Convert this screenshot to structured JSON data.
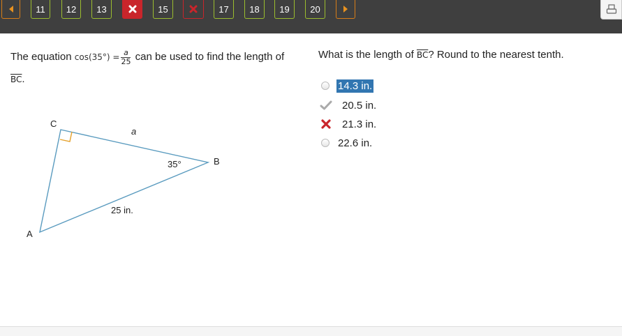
{
  "nav": {
    "prev_icon": "left-arrow-icon",
    "next_icon": "right-arrow-icon",
    "items": [
      {
        "label": "11",
        "status": "normal"
      },
      {
        "label": "12",
        "status": "normal"
      },
      {
        "label": "13",
        "status": "normal"
      },
      {
        "label": "",
        "status": "wrong",
        "icon": "x-icon"
      },
      {
        "label": "15",
        "status": "normal"
      },
      {
        "label": "",
        "status": "wrong-outline",
        "icon": "x-icon"
      },
      {
        "label": "17",
        "status": "normal"
      },
      {
        "label": "18",
        "status": "normal"
      },
      {
        "label": "19",
        "status": "normal"
      },
      {
        "label": "20",
        "status": "normal"
      }
    ],
    "print_icon": "print-icon"
  },
  "question": {
    "prompt_start": "The equation ",
    "cos_text": "cos(35°) =",
    "frac_num": "a",
    "frac_den": "25",
    "prompt_end": " can be used to find the length of",
    "segment": "BC",
    "segment_end": ".",
    "right_prefix": "What is the length of ",
    "right_segment": "BC",
    "right_suffix": "? Round to the nearest tenth."
  },
  "diagram": {
    "vertex_c": "C",
    "vertex_b": "B",
    "vertex_a": "A",
    "side_a": "a",
    "angle_b": "35°",
    "hypotenuse": "25 in."
  },
  "options": [
    {
      "label": "14.3 in.",
      "marker": "radio",
      "selected": true
    },
    {
      "label": "20.5 in.",
      "marker": "check-icon",
      "selected": false
    },
    {
      "label": "21.3 in.",
      "marker": "x-icon",
      "selected": false
    },
    {
      "label": "22.6 in.",
      "marker": "radio",
      "selected": false
    }
  ],
  "colors": {
    "topbar": "#3f3f3f",
    "nav_border": "#9bbd2e",
    "wrong": "#c9252b",
    "selected": "#3276b1",
    "right_angle": "#e5a12b",
    "triangle": "#5a9bbf"
  }
}
